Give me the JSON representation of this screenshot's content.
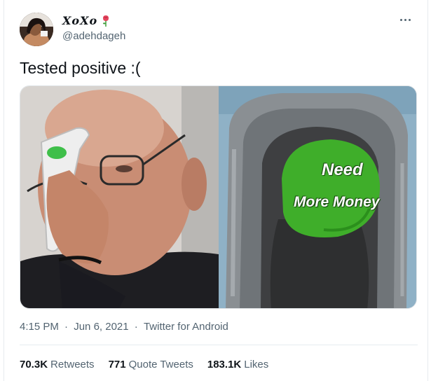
{
  "author": {
    "display_name": "XoXo",
    "handle": "@adehdageh",
    "avatar_icon": "profile-photo",
    "name_emoji_icon": "rose-icon"
  },
  "tweet": {
    "text": "Tested positive :(",
    "media_left_icon": "thermometer-photo",
    "media_right_icon": "meter-photo",
    "overlay_line1": "Need",
    "overlay_line2": "More Money"
  },
  "meta": {
    "time": "4:15 PM",
    "separator": "·",
    "date": "Jun 6, 2021",
    "source": "Twitter for Android"
  },
  "stats": [
    {
      "count": "70.3K",
      "label": "Retweets"
    },
    {
      "count": "771",
      "label": "Quote Tweets"
    },
    {
      "count": "183.1K",
      "label": "Likes"
    }
  ],
  "colors": {
    "text_primary": "#0f1419",
    "text_secondary": "#536471",
    "border": "#e6ecf0",
    "meter_green": "#3fae2a"
  }
}
